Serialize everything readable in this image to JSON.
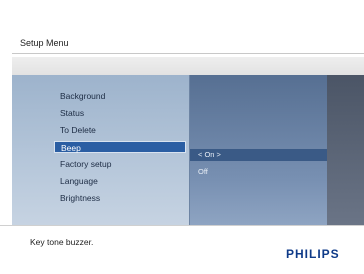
{
  "header": {
    "title": "Setup Menu"
  },
  "menu": {
    "items": [
      {
        "label": "Background"
      },
      {
        "label": "Status"
      },
      {
        "label": "To Delete"
      },
      {
        "label": "Beep"
      },
      {
        "label": "Factory setup"
      },
      {
        "label": "Language"
      },
      {
        "label": "Brightness"
      }
    ],
    "selected_label": "Beep"
  },
  "options": {
    "items": [
      {
        "label": "< On >"
      },
      {
        "label": "Off"
      }
    ]
  },
  "footer": {
    "help_text": "Key tone buzzer.",
    "brand": "PHILIPS"
  },
  "colors": {
    "selection": "#2a5ea3",
    "brand": "#0e3a88"
  }
}
